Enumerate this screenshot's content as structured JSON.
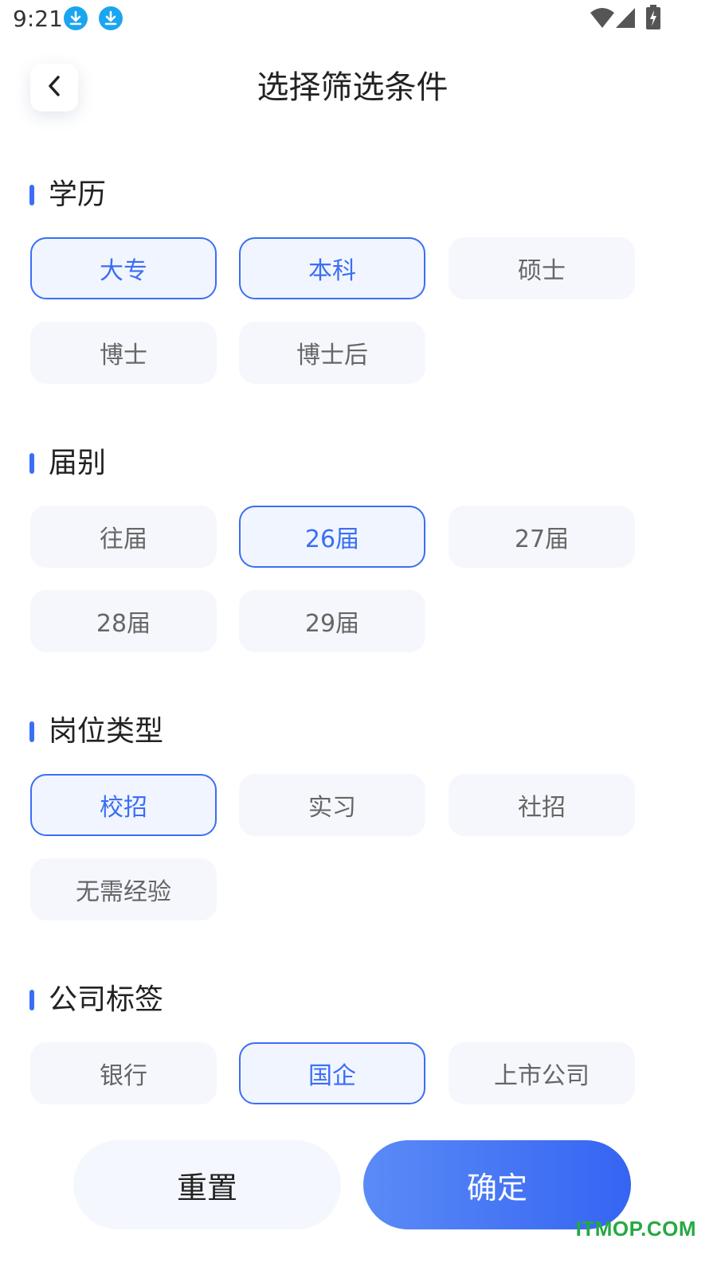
{
  "status_bar": {
    "time": "9:21",
    "icons": [
      "download-icon",
      "download-icon",
      "wifi-icon",
      "signal-icon",
      "battery-charging-icon"
    ]
  },
  "header": {
    "back_icon": "chevron-left-icon",
    "title": "选择筛选条件"
  },
  "sections": [
    {
      "title": "学历",
      "options": [
        {
          "label": "大专",
          "selected": true
        },
        {
          "label": "本科",
          "selected": true
        },
        {
          "label": "硕士",
          "selected": false
        },
        {
          "label": "博士",
          "selected": false
        },
        {
          "label": "博士后",
          "selected": false
        }
      ]
    },
    {
      "title": "届别",
      "options": [
        {
          "label": "往届",
          "selected": false
        },
        {
          "label": "26届",
          "selected": true
        },
        {
          "label": "27届",
          "selected": false
        },
        {
          "label": "28届",
          "selected": false
        },
        {
          "label": "29届",
          "selected": false
        }
      ]
    },
    {
      "title": "岗位类型",
      "options": [
        {
          "label": "校招",
          "selected": true
        },
        {
          "label": "实习",
          "selected": false
        },
        {
          "label": "社招",
          "selected": false
        },
        {
          "label": "无需经验",
          "selected": false
        }
      ]
    },
    {
      "title": "公司标签",
      "options": [
        {
          "label": "银行",
          "selected": false
        },
        {
          "label": "国企",
          "selected": true
        },
        {
          "label": "上市公司",
          "selected": false
        }
      ]
    }
  ],
  "footer": {
    "reset_label": "重置",
    "confirm_label": "确定"
  },
  "watermark": "ITMOP.COM",
  "colors": {
    "accent": "#3b6ef5",
    "chip_bg": "#f5f7fd",
    "watermark": "#27a843"
  }
}
